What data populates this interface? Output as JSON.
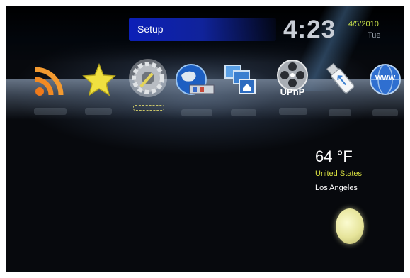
{
  "header": {
    "title": "Setup",
    "time": "4:23",
    "date": "4/5/2010",
    "weekday": "Tue"
  },
  "menu": {
    "items": [
      {
        "id": "rss",
        "icon": "rss-icon",
        "label": ""
      },
      {
        "id": "favorites",
        "icon": "star-icon",
        "label": ""
      },
      {
        "id": "setup",
        "icon": "gear-icon",
        "label": "",
        "selected": true
      },
      {
        "id": "network",
        "icon": "globe-network-icon",
        "label": ""
      },
      {
        "id": "computer",
        "icon": "computer-home-icon",
        "label": ""
      },
      {
        "id": "upnp",
        "icon": "film-reel-icon",
        "label": "UPnP"
      },
      {
        "id": "usb",
        "icon": "usb-drive-icon",
        "label": ""
      },
      {
        "id": "web",
        "icon": "www-globe-icon",
        "label": "WWW"
      }
    ]
  },
  "weather": {
    "temperature": "64 °F",
    "country": "United States",
    "city": "Los Angeles",
    "icon": "moon-icon"
  }
}
